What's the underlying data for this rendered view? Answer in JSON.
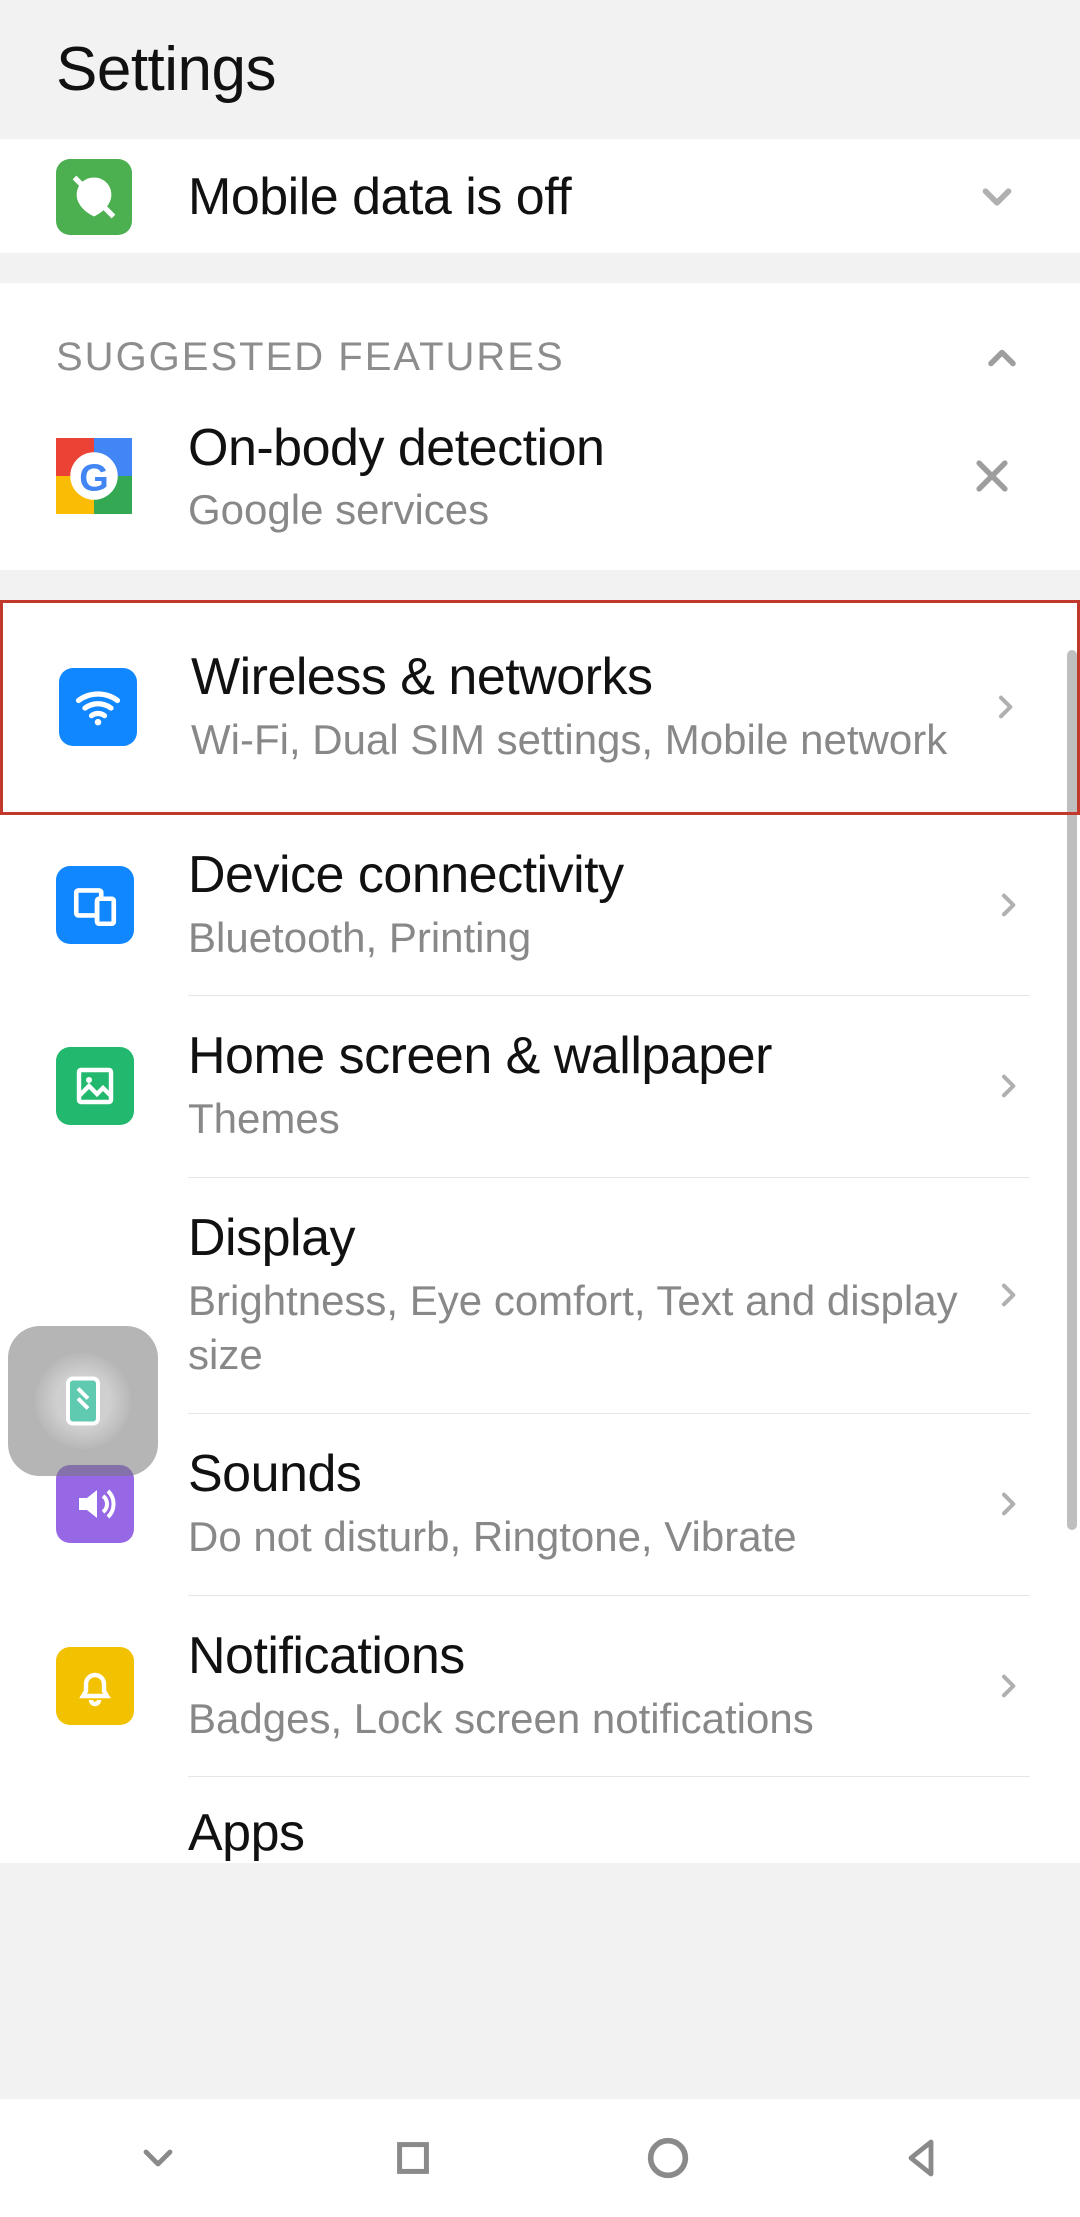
{
  "header": {
    "title": "Settings"
  },
  "status": {
    "label": "Mobile data is off"
  },
  "suggested": {
    "header": "SUGGESTED FEATURES",
    "item": {
      "title": "On-body detection",
      "subtitle": "Google services"
    }
  },
  "items": [
    {
      "title": "Wireless & networks",
      "subtitle": "Wi-Fi, Dual SIM settings, Mobile network"
    },
    {
      "title": "Device connectivity",
      "subtitle": "Bluetooth, Printing"
    },
    {
      "title": "Home screen & wallpaper",
      "subtitle": "Themes"
    },
    {
      "title": "Display",
      "subtitle": "Brightness, Eye comfort, Text and display size"
    },
    {
      "title": "Sounds",
      "subtitle": "Do not disturb, Ringtone, Vibrate"
    },
    {
      "title": "Notifications",
      "subtitle": "Badges, Lock screen notifications"
    },
    {
      "title": "Apps",
      "subtitle": ""
    }
  ],
  "icons": {
    "status": "leaf-off-icon",
    "suggested": "google-icon",
    "wifi": "wifi-icon",
    "device": "devices-icon",
    "home": "wallpaper-icon",
    "display": "display-icon",
    "sounds": "speaker-icon",
    "notif": "bell-icon"
  },
  "colors": {
    "highlight_border": "#c0392b",
    "blue": "#1187ff",
    "green": "#22b86d",
    "purple": "#9668e6",
    "amber": "#f2c200",
    "teal": "#3cbfa3",
    "google_g": [
      "#ea4335",
      "#fbbc05",
      "#34a853",
      "#4285f4"
    ]
  }
}
